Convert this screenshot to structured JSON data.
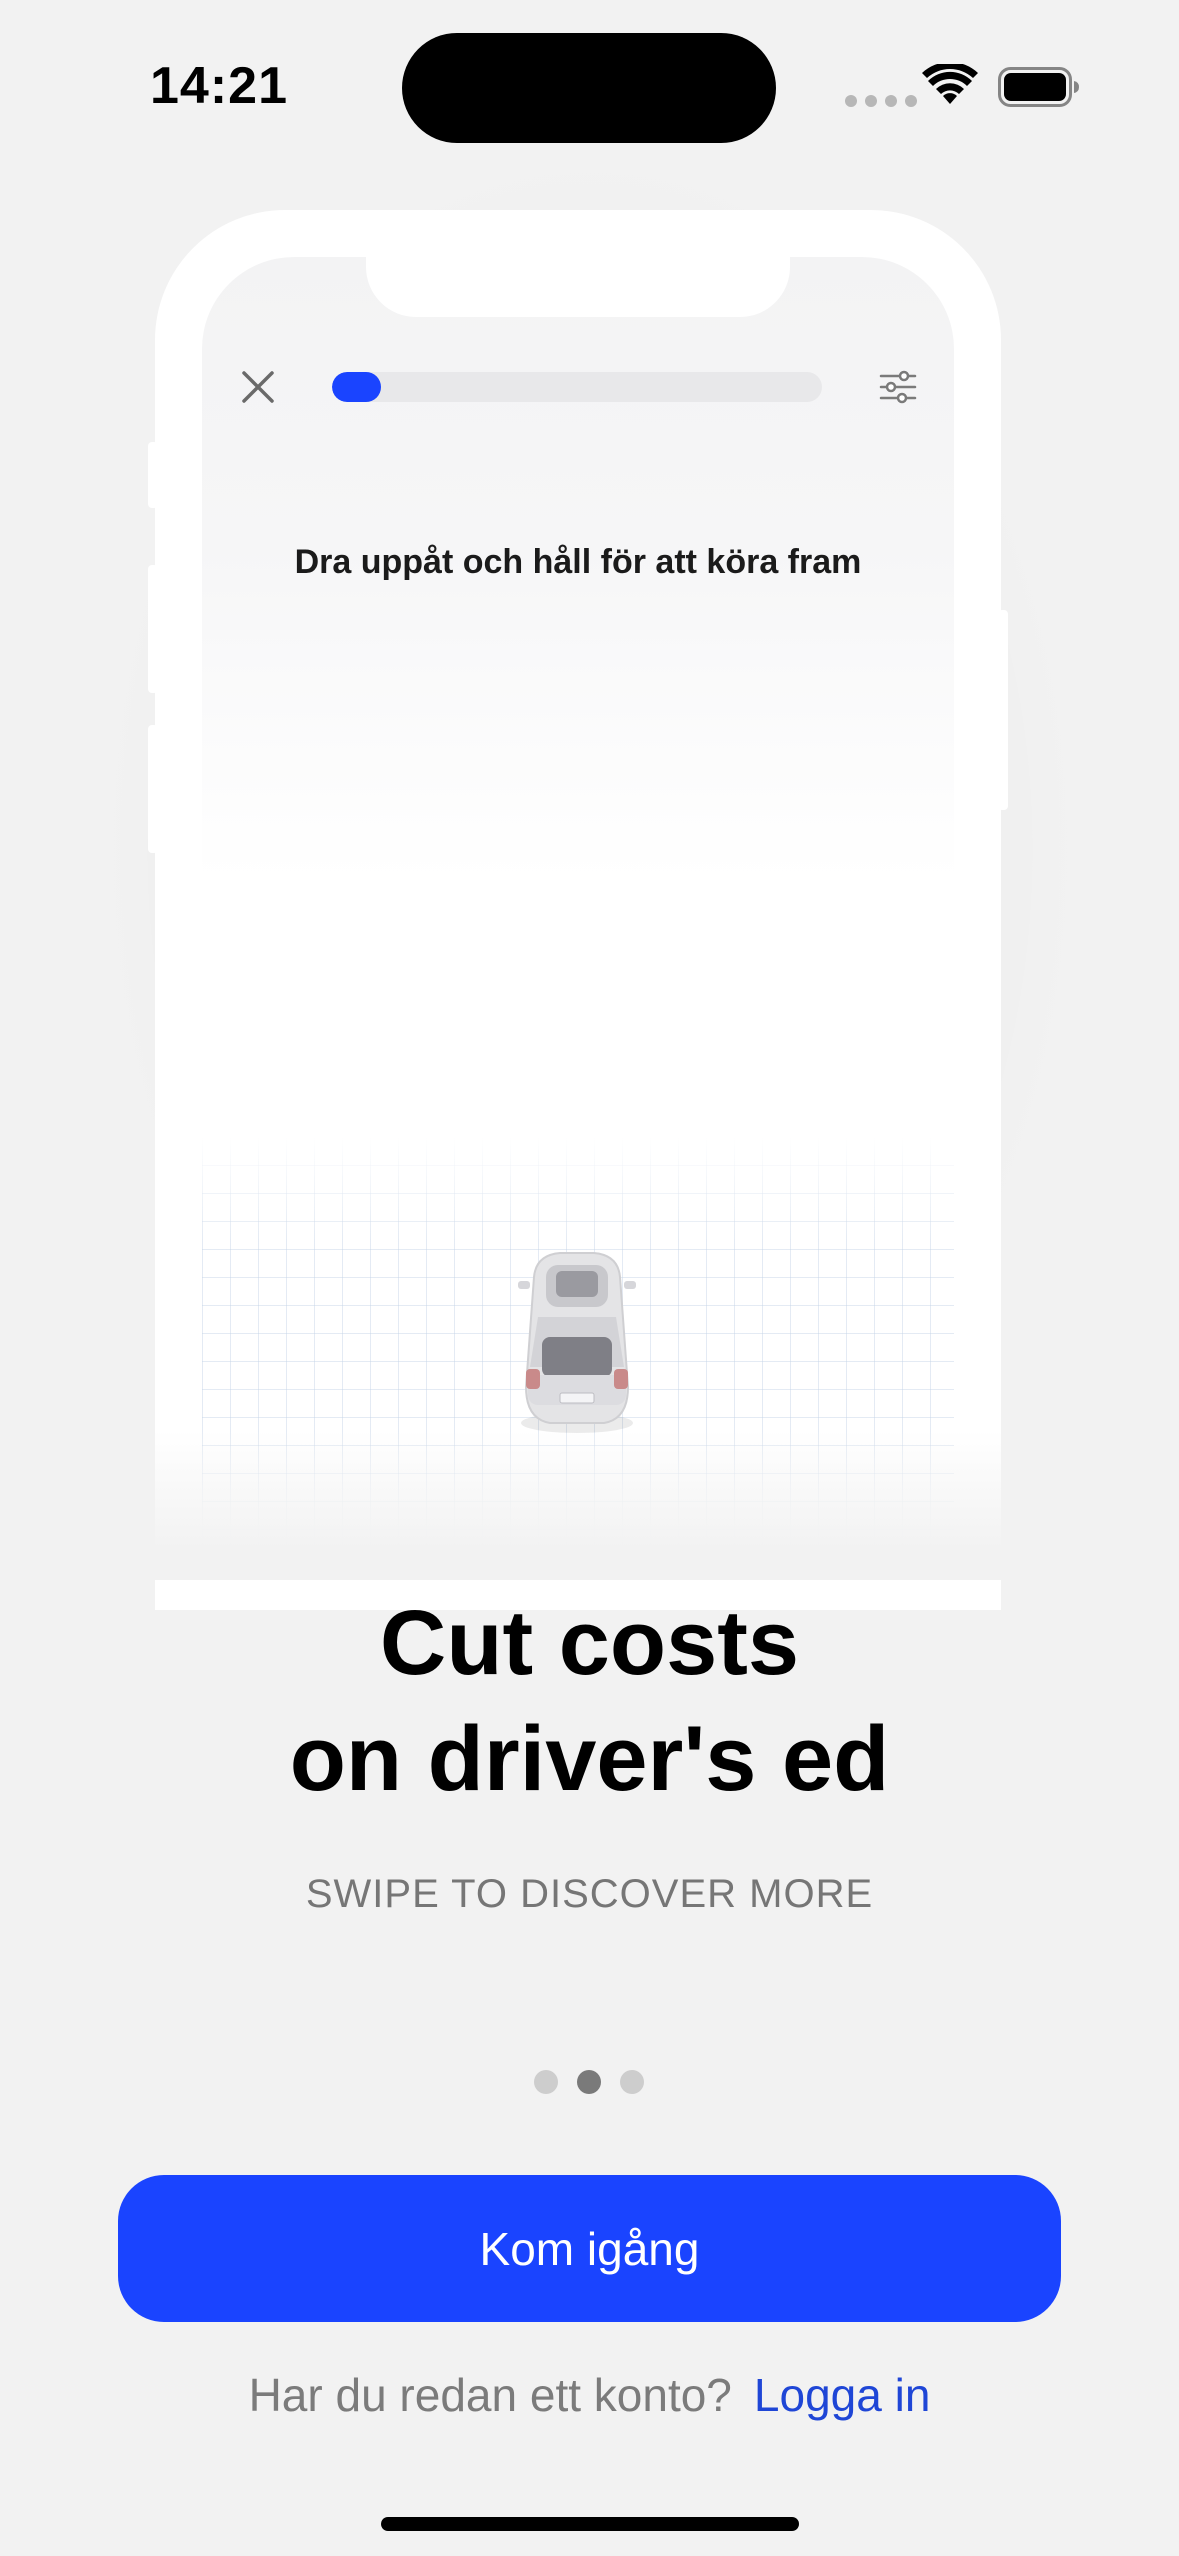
{
  "status_bar": {
    "time": "14:21",
    "icons": [
      "cellular-signal-icon",
      "wifi-icon",
      "battery-icon"
    ]
  },
  "mockup": {
    "progress_fraction": 0.1,
    "instruction": "Dra uppåt och håll för att köra fram",
    "icons": [
      "close-icon",
      "settings-sliders-icon",
      "car-icon"
    ]
  },
  "onboarding": {
    "headline_line1": "Cut costs",
    "headline_line2": "on driver's ed",
    "subtitle": "SWIPE TO DISCOVER MORE",
    "page_count": 3,
    "active_page": 2
  },
  "actions": {
    "primary_label": "Kom igång",
    "login_question": "Har du redan ett konto?",
    "login_link": "Logga in"
  },
  "colors": {
    "accent": "#1a44ff",
    "link": "#1f46d6",
    "background": "#f2f2f2"
  }
}
